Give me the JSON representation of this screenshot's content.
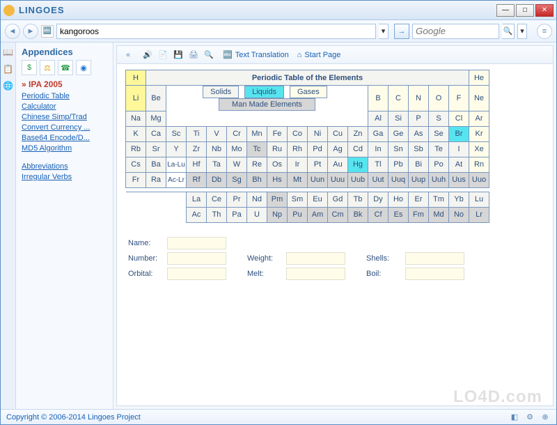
{
  "brand": "LINGOES",
  "toolbar": {
    "address_value": "kangoroos",
    "search_placeholder": "Google"
  },
  "content_toolbar": {
    "text_translation": "Text Translation",
    "start_page": "Start Page"
  },
  "sidebar": {
    "title": "Appendices",
    "active": "IPA 2005",
    "links": [
      "Periodic Table",
      "Calculator",
      "Chinese Simp/Trad",
      "Convert Currency ...",
      "Base64 Encode/D...",
      "MD5 Algorithm"
    ],
    "links2": [
      "Abbreviations",
      "Irregular Verbs"
    ]
  },
  "pt": {
    "title": "Periodic Table of the Elements",
    "legend": {
      "solids": "Solids",
      "liquids": "Liquids",
      "gases": "Gases",
      "mm": "Man Made Elements"
    },
    "row1": [
      "H",
      "",
      "",
      "",
      "",
      "",
      "",
      "",
      "",
      "",
      "",
      "",
      "",
      "",
      "",
      "",
      "",
      "He"
    ],
    "row2": [
      "Li",
      "Be",
      "",
      "",
      "",
      "",
      "",
      "",
      "",
      "",
      "",
      "",
      "B",
      "C",
      "N",
      "O",
      "F",
      "Ne"
    ],
    "row3": [
      "Na",
      "Mg",
      "",
      "",
      "",
      "",
      "",
      "",
      "",
      "",
      "",
      "",
      "Al",
      "Si",
      "P",
      "S",
      "Cl",
      "Ar"
    ],
    "row4": [
      "K",
      "Ca",
      "Sc",
      "Ti",
      "V",
      "Cr",
      "Mn",
      "Fe",
      "Co",
      "Ni",
      "Cu",
      "Zn",
      "Ga",
      "Ge",
      "As",
      "Se",
      "Br",
      "Kr"
    ],
    "row5": [
      "Rb",
      "Sr",
      "Y",
      "Zr",
      "Nb",
      "Mo",
      "Tc",
      "Ru",
      "Rh",
      "Pd",
      "Ag",
      "Cd",
      "In",
      "Sn",
      "Sb",
      "Te",
      "I",
      "Xe"
    ],
    "row6": [
      "Cs",
      "Ba",
      "La-Lu",
      "Hf",
      "Ta",
      "W",
      "Re",
      "Os",
      "Ir",
      "Pt",
      "Au",
      "Hg",
      "Tl",
      "Pb",
      "Bi",
      "Po",
      "At",
      "Rn"
    ],
    "row7": [
      "Fr",
      "Ra",
      "Ac-Lr",
      "Rf",
      "Db",
      "Sg",
      "Bh",
      "Hs",
      "Mt",
      "Uun",
      "Uuu",
      "Uub",
      "Uut",
      "Uuq",
      "Uup",
      "Uuh",
      "Uus",
      "Uuo"
    ],
    "lan": [
      "",
      "",
      "",
      "La",
      "Ce",
      "Pr",
      "Nd",
      "Pm",
      "Sm",
      "Eu",
      "Gd",
      "Tb",
      "Dy",
      "Ho",
      "Er",
      "Tm",
      "Yb",
      "Lu",
      ""
    ],
    "act": [
      "",
      "",
      "",
      "Ac",
      "Th",
      "Pa",
      "U",
      "Np",
      "Pu",
      "Am",
      "Cm",
      "Bk",
      "Cf",
      "Es",
      "Fm",
      "Md",
      "No",
      "Lr",
      ""
    ]
  },
  "details": {
    "name_label": "Name:",
    "number_label": "Number:",
    "weight_label": "Weight:",
    "shells_label": "Shells:",
    "orbital_label": "Orbital:",
    "melt_label": "Melt:",
    "boil_label": "Boil:"
  },
  "statusbar": {
    "copyright": "Copyright © 2006-2014 Lingoes Project"
  },
  "watermark": "LO4D.com",
  "cell_classes": {
    "H": "el-H",
    "He": "el-noble",
    "Ne": "el-noble",
    "Ar": "el-noble",
    "Kr": "el-noble",
    "Xe": "el-noble",
    "Rn": "el-noble",
    "Br": "el-liq",
    "Hg": "el-liq",
    "Tc": "el-mm",
    "Pm": "el-mm",
    "Np": "el-mm",
    "Pu": "el-mm",
    "Am": "el-mm",
    "Cm": "el-mm",
    "Bk": "el-mm",
    "Cf": "el-mm",
    "Es": "el-mm",
    "Fm": "el-mm",
    "Md": "el-mm",
    "No": "el-mm",
    "Lr": "el-mm",
    "Rf": "el-mm",
    "Db": "el-mm",
    "Sg": "el-mm",
    "Bh": "el-mm",
    "Hs": "el-mm",
    "Mt": "el-mm",
    "Uun": "el-mm",
    "Uuu": "el-mm",
    "Uub": "el-mm",
    "Uut": "el-mm",
    "Uuq": "el-mm",
    "Uup": "el-mm",
    "Uuh": "el-mm",
    "Uus": "el-mm",
    "Uuo": "el-mm",
    "N": "el-noble",
    "O": "el-noble",
    "F": "el-noble",
    "Cl": "el-noble",
    "C": "el-noble",
    "B": "el-noble",
    "Li": "el-H",
    "Be": "el-std",
    "Na": "el-std",
    "Mg": "el-std"
  }
}
